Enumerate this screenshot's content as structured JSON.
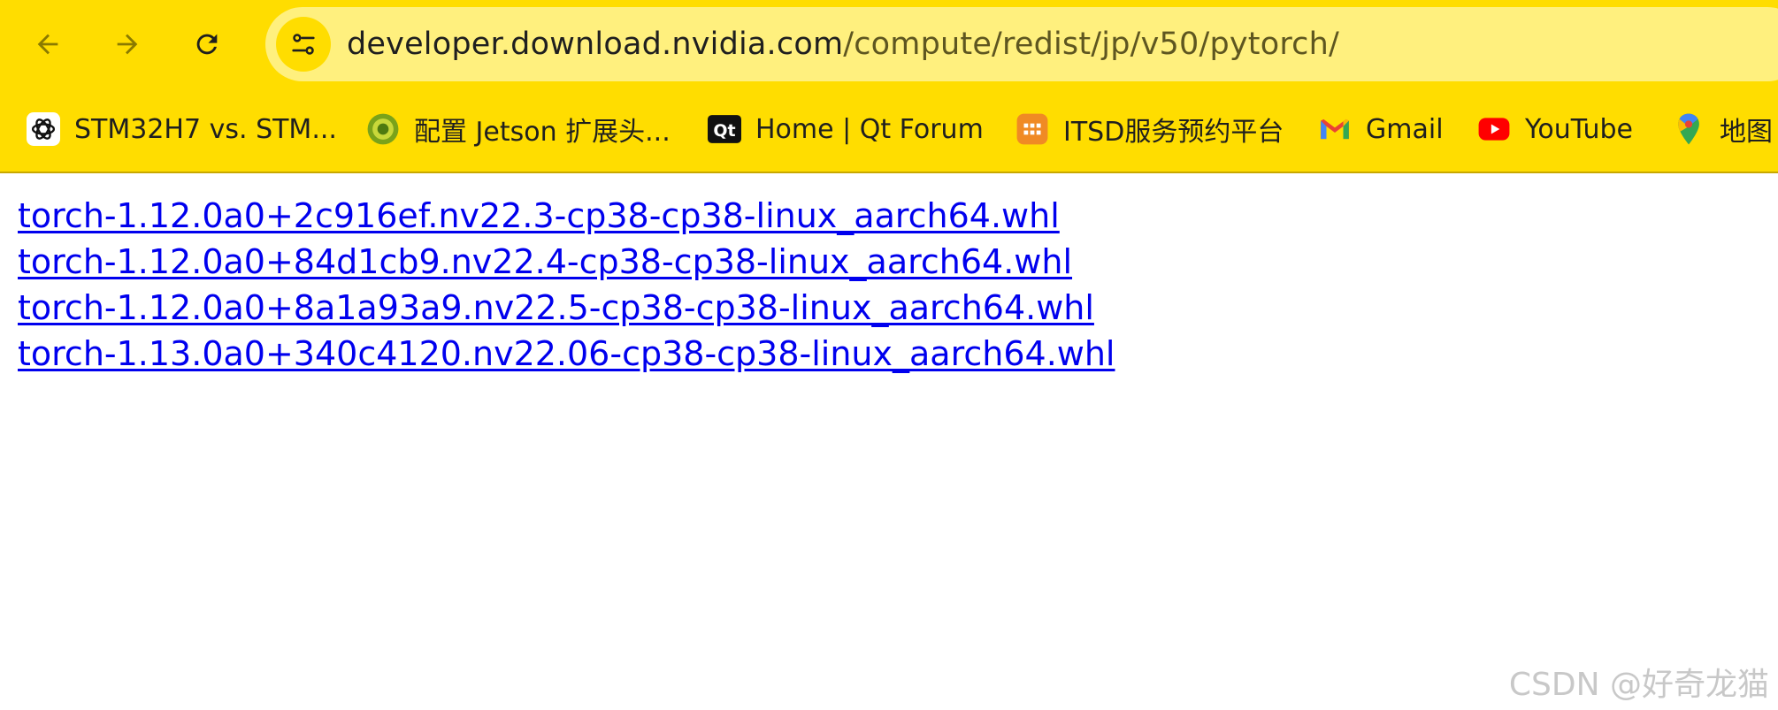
{
  "address_bar": {
    "url_host": "developer.download.nvidia.com",
    "url_path": "/compute/redist/jp/v50/pytorch/"
  },
  "nav": {
    "back_icon": "arrow-left-icon",
    "forward_icon": "arrow-right-icon",
    "reload_icon": "reload-icon",
    "site_info_icon": "tune-icon"
  },
  "bookmarks": [
    {
      "label": "STM32H7 vs. STM...",
      "icon": "openai-icon"
    },
    {
      "label": "配置 Jetson 扩展头...",
      "icon": "circle-logo-icon"
    },
    {
      "label": "Home | Qt Forum",
      "icon": "qt-icon"
    },
    {
      "label": "ITSD服务预约平台",
      "icon": "calendar-icon"
    },
    {
      "label": "Gmail",
      "icon": "gmail-icon"
    },
    {
      "label": "YouTube",
      "icon": "youtube-icon"
    },
    {
      "label": "地图",
      "icon": "maps-pin-icon"
    }
  ],
  "files": [
    "torch-1.12.0a0+2c916ef.nv22.3-cp38-cp38-linux_aarch64.whl",
    "torch-1.12.0a0+84d1cb9.nv22.4-cp38-cp38-linux_aarch64.whl",
    "torch-1.12.0a0+8a1a93a9.nv22.5-cp38-cp38-linux_aarch64.whl",
    "torch-1.13.0a0+340c4120.nv22.06-cp38-cp38-linux_aarch64.whl"
  ],
  "watermark": "CSDN @好奇龙猫",
  "colors": {
    "toolbar_bg": "#ffdd00",
    "omnibox_bg": "#fff07e",
    "link": "#0000ee"
  }
}
